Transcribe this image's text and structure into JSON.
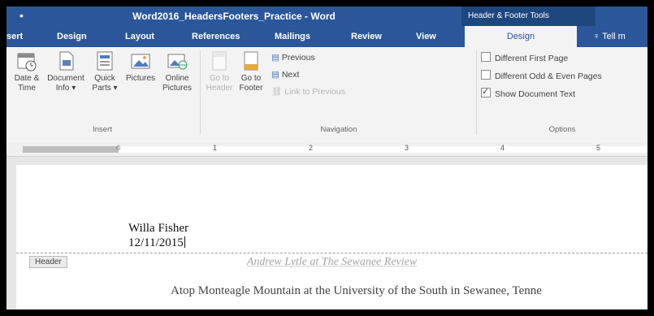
{
  "window": {
    "title": "Word2016_HeadersFooters_Practice - Word",
    "context_tab_title": "Header & Footer Tools"
  },
  "tabs": {
    "insert": "sert",
    "design": "Design",
    "layout": "Layout",
    "references": "References",
    "mailings": "Mailings",
    "review": "Review",
    "view": "View",
    "hf_design": "Design",
    "tell_me": "Tell m"
  },
  "ribbon": {
    "insert_group": {
      "label": "Insert",
      "date_time": "Date & Time",
      "document_info": "Document Info",
      "quick_parts": "Quick Parts",
      "pictures": "Pictures",
      "online_pictures": "Online Pictures"
    },
    "navigation_group": {
      "label": "Navigation",
      "go_to_header": "Go to Header",
      "go_to_footer": "Go to Footer",
      "previous": "Previous",
      "next": "Next",
      "link_to_previous": "Link to Previous"
    },
    "options_group": {
      "label": "Options",
      "different_first_page": "Different First Page",
      "different_odd_even": "Different Odd & Even Pages",
      "show_document_text": "Show Document Text",
      "different_first_page_checked": false,
      "different_odd_even_checked": false,
      "show_document_text_checked": true
    }
  },
  "ruler": {
    "numbers": [
      "1",
      "2",
      "3",
      "4",
      "5"
    ]
  },
  "document": {
    "author_name": "Willa Fisher",
    "date": "12/11/2015",
    "header_tag": "Header",
    "article_title": "Andrew Lytle at The Sewanee Review",
    "body_text": "Atop Monteagle Mountain at the University of the South in Sewanee, Tenne"
  },
  "colors": {
    "word_blue": "#2b579a",
    "context_blue": "#1f477f",
    "ribbon_bg": "#f3f3f3"
  }
}
